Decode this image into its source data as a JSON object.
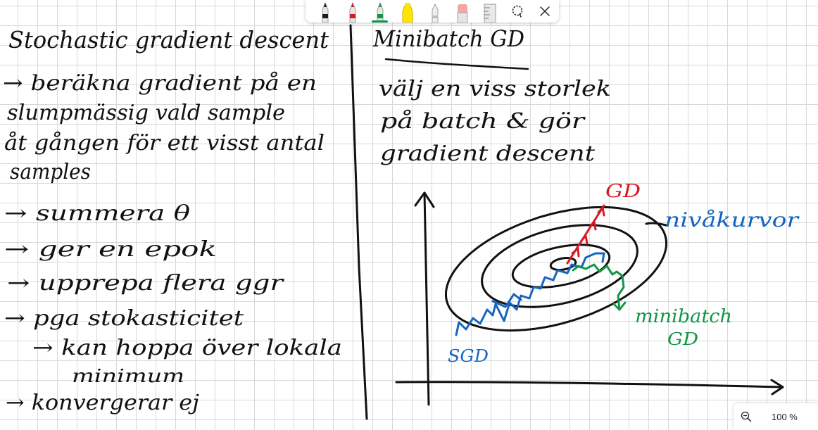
{
  "toolbar": {
    "tools": [
      {
        "name": "black-pen",
        "color": "#1a1a1a"
      },
      {
        "name": "red-pen",
        "color": "#d71920"
      },
      {
        "name": "green-pen",
        "color": "#119646",
        "selected": true
      },
      {
        "name": "yellow-highlighter",
        "color": "#ffe500"
      },
      {
        "name": "pencil",
        "color": "#bdbdbd"
      },
      {
        "name": "eraser",
        "color": "#f3a6a6"
      },
      {
        "name": "ruler",
        "color": "#cfcfcf"
      }
    ],
    "lasso_icon": "lasso-icon",
    "close_icon": "close-icon"
  },
  "notes": {
    "left": {
      "title": "Stochastic gradient descent",
      "lines": [
        "→ beräkna gradient på en",
        "slumpmässig vald sample",
        "åt gången för ett visst antal",
        "samples",
        "→ summera θ",
        "→ ger en epok",
        "→ upprepa flera ggr",
        "→ pgа stokasticitet",
        "→ kan hoppa över lokala",
        "minimum",
        "→ konvergerar ej"
      ]
    },
    "right": {
      "title": "Minibatch GD",
      "lines": [
        "välj en viss storlek",
        "på batch & gör",
        "gradient descent"
      ],
      "diagram": {
        "labels": {
          "gd": "GD",
          "sgd": "SGD",
          "level_curves": "nivåkurvor",
          "minibatch": "minibatch",
          "minibatch_gd": "GD"
        },
        "colors": {
          "gd": "#d71920",
          "sgd": "#1565c0",
          "minibatch": "#119646",
          "ink": "#111111"
        }
      }
    }
  },
  "zoom": {
    "level": "100 %",
    "icon": "zoom-out-icon"
  }
}
